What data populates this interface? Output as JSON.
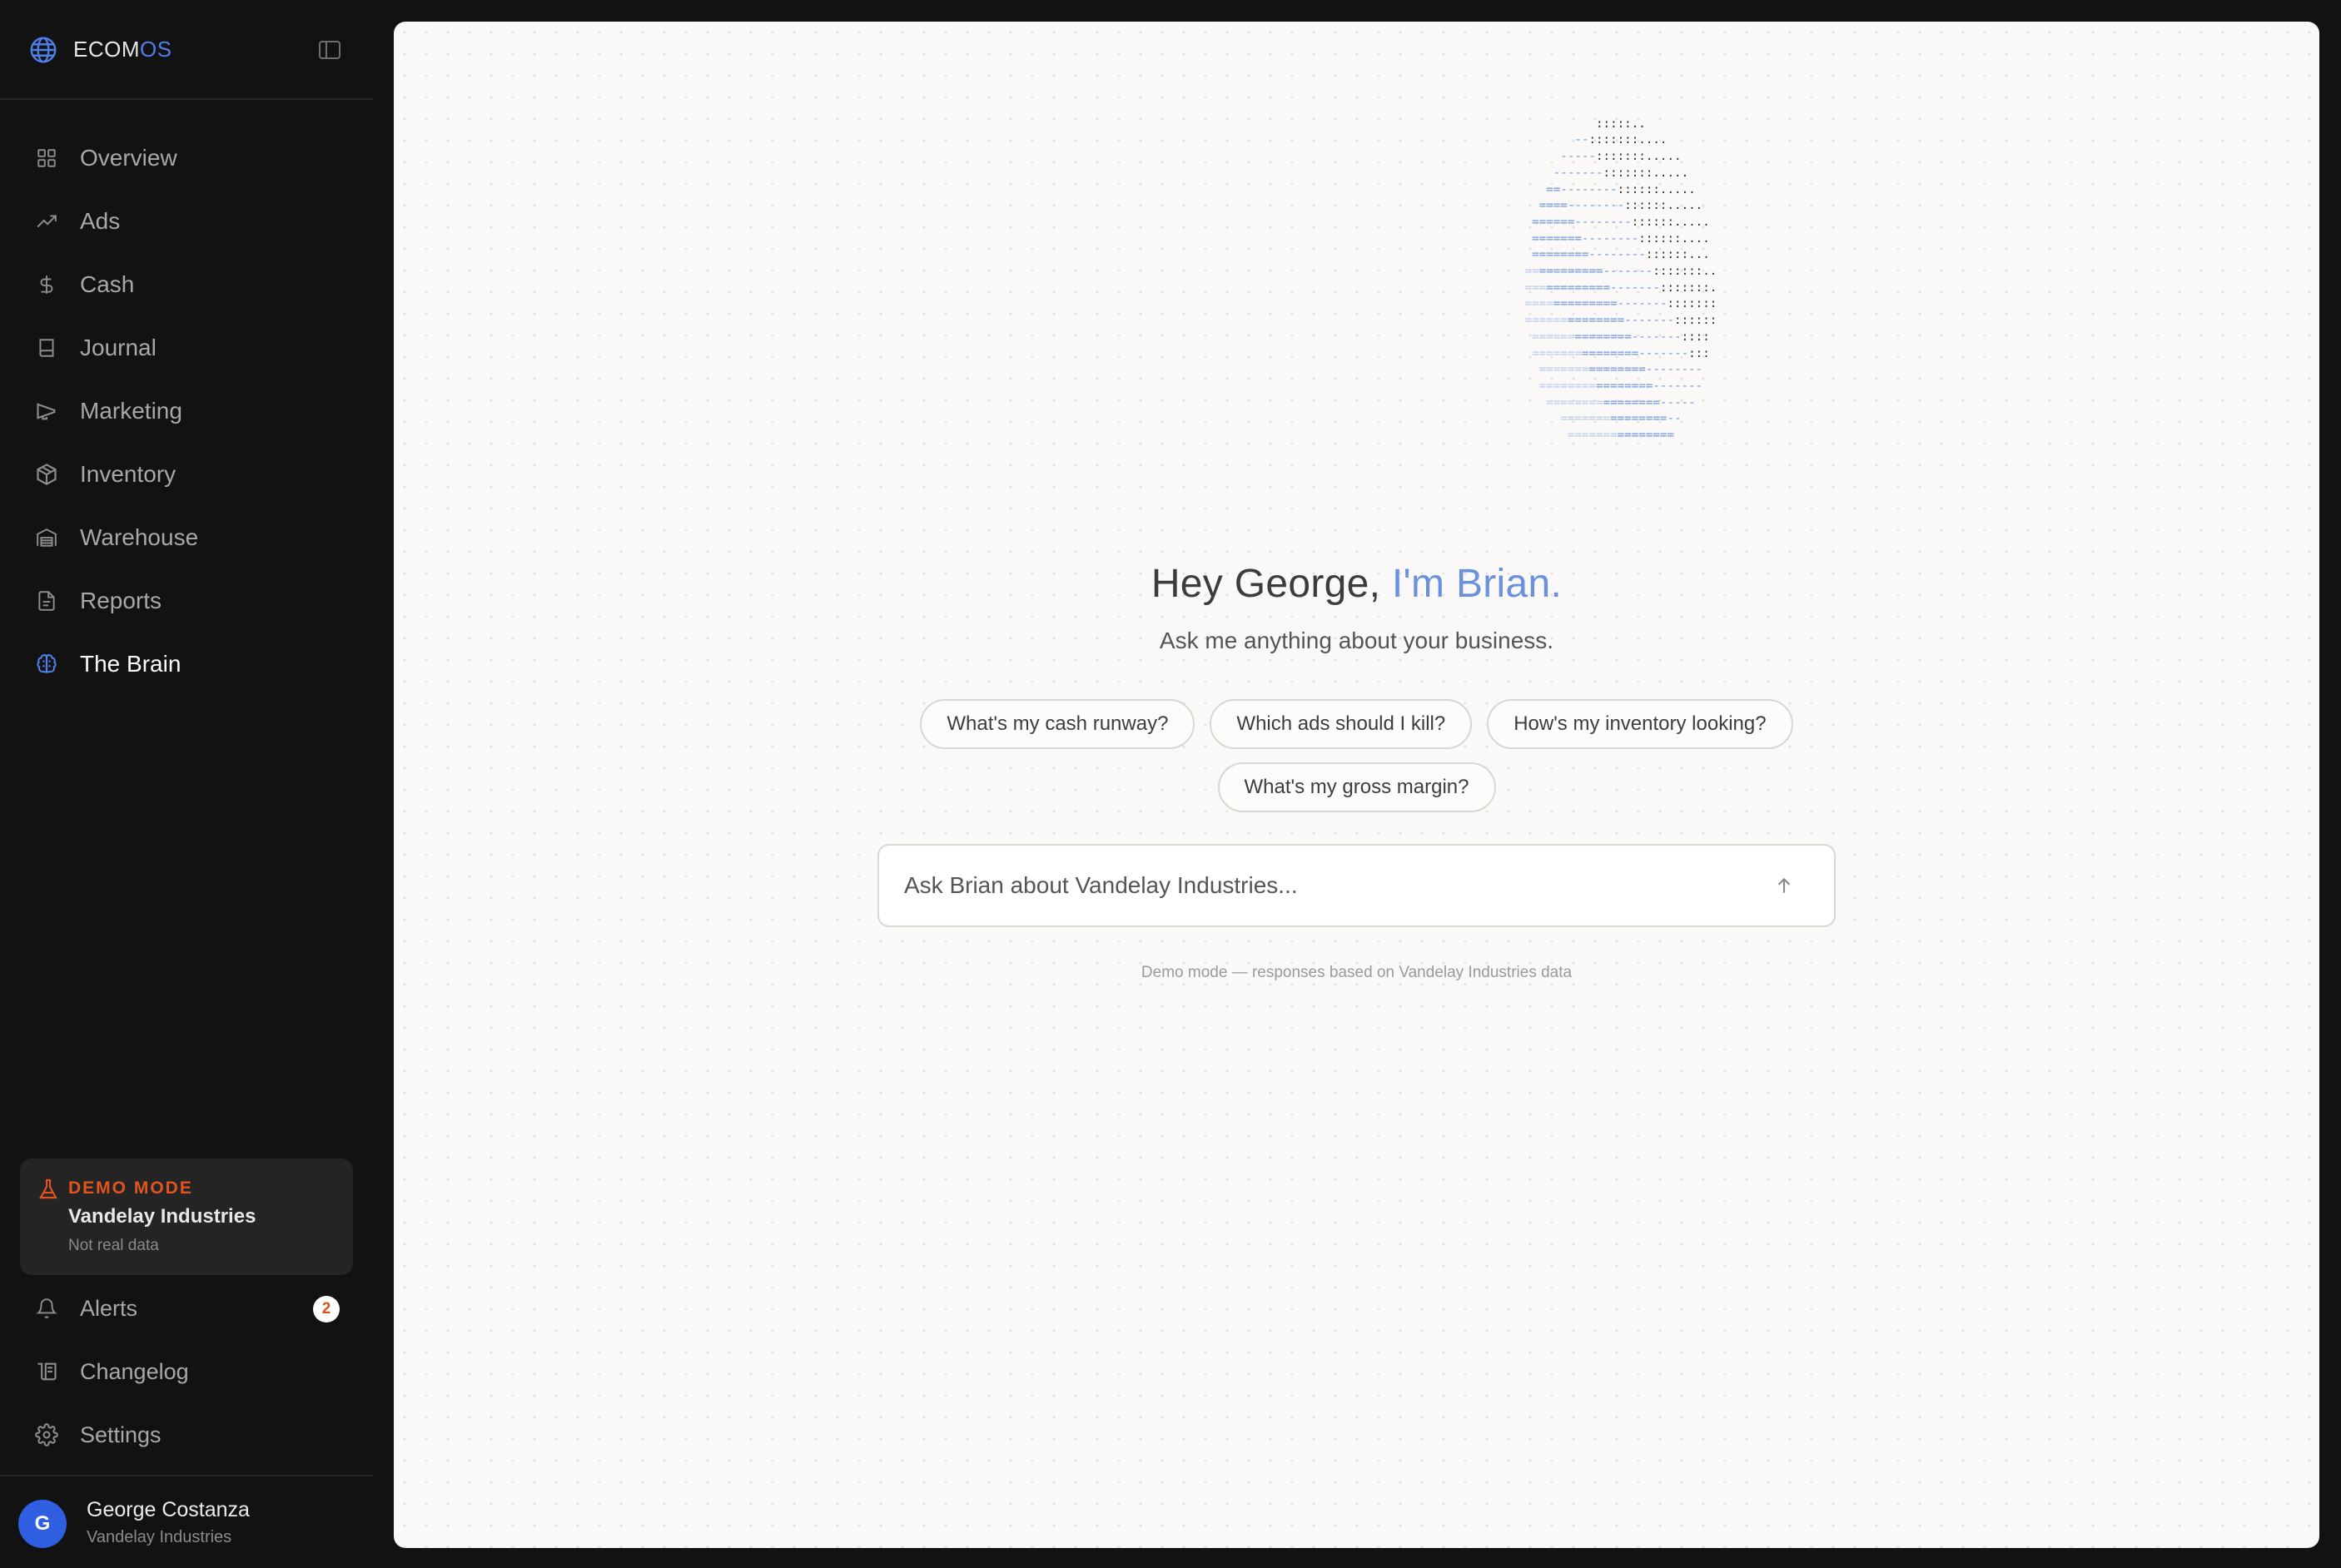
{
  "brand": {
    "name_main": "ECOM",
    "name_accent": "OS",
    "accent_color": "#4f7ee8"
  },
  "sidebar": {
    "items": [
      {
        "label": "Overview",
        "icon": "grid-icon"
      },
      {
        "label": "Ads",
        "icon": "trending-up-icon"
      },
      {
        "label": "Cash",
        "icon": "dollar-icon"
      },
      {
        "label": "Journal",
        "icon": "book-icon"
      },
      {
        "label": "Marketing",
        "icon": "megaphone-icon"
      },
      {
        "label": "Inventory",
        "icon": "box-icon"
      },
      {
        "label": "Warehouse",
        "icon": "warehouse-icon"
      },
      {
        "label": "Reports",
        "icon": "file-icon"
      },
      {
        "label": "The Brain",
        "icon": "brain-icon",
        "active": true
      }
    ],
    "demo": {
      "title": "DEMO MODE",
      "company": "Vandelay Industries",
      "subtitle": "Not real data",
      "color": "#e0551f"
    },
    "bottom_items": [
      {
        "label": "Alerts",
        "icon": "bell-icon",
        "badge": "2"
      },
      {
        "label": "Changelog",
        "icon": "changelog-icon"
      },
      {
        "label": "Settings",
        "icon": "gear-icon"
      }
    ],
    "user": {
      "initial": "G",
      "name": "George Costanza",
      "company": "Vandelay Industries",
      "avatar_color": "#2f5fe0"
    }
  },
  "main": {
    "greeting_prefix": "Hey George, ",
    "greeting_name": "I'm Brian.",
    "subtitle": "Ask me anything about your business.",
    "suggestions": [
      "What's my cash runway?",
      "Which ads should I kill?",
      "How's my inventory looking?",
      "What's my gross margin?"
    ],
    "input_placeholder": "Ask Brian about Vandelay Industries...",
    "footnote": "Demo mode — responses based on Vandelay Industries data"
  }
}
